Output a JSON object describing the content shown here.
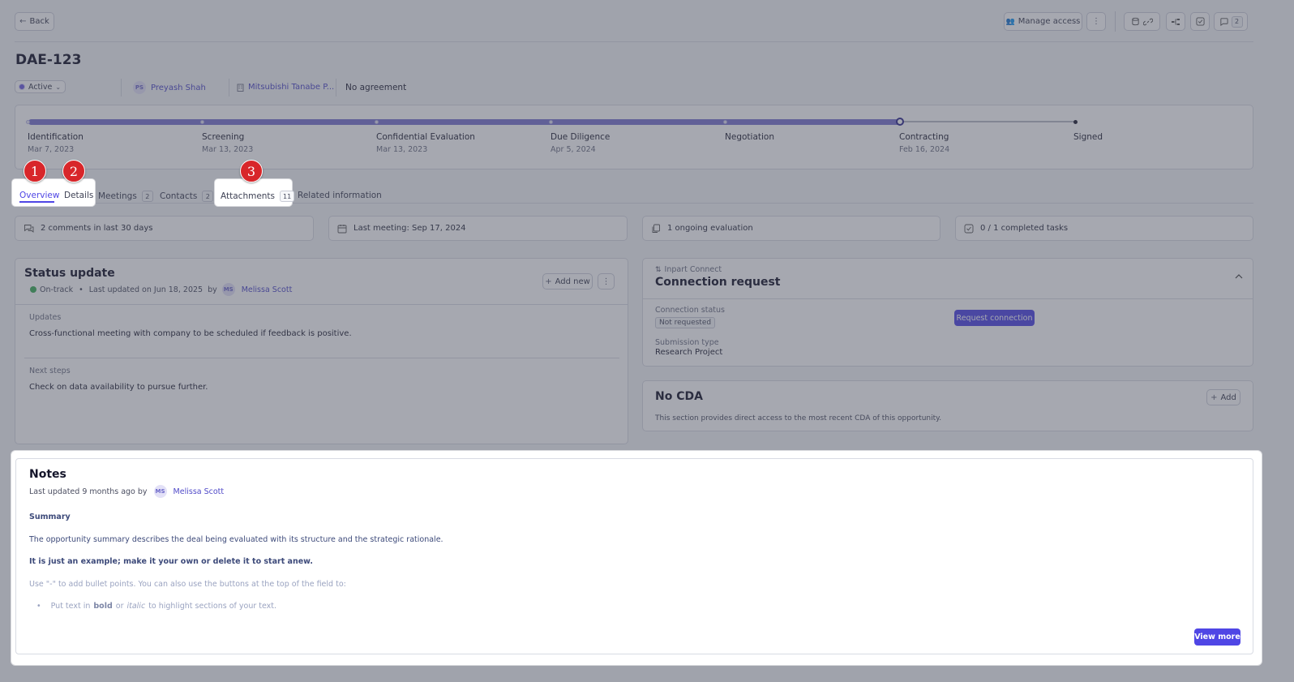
{
  "header": {
    "back_label": "Back",
    "manage_access_label": "Manage access",
    "comments_count": "2"
  },
  "deal": {
    "id": "DAE-123",
    "status": "Active",
    "owner_initials": "PS",
    "owner_name": "Preyash Shah",
    "company": "Mitsubishi Tanabe P...",
    "agreement": "No agreement"
  },
  "pipeline": {
    "stages": [
      {
        "label": "Identification",
        "date": "Mar 7, 2023"
      },
      {
        "label": "Screening",
        "date": "Mar 13, 2023"
      },
      {
        "label": "Confidential Evaluation",
        "date": "Mar 13, 2023"
      },
      {
        "label": "Due Diligence",
        "date": "Apr 5, 2024"
      },
      {
        "label": "Negotiation",
        "date": ""
      },
      {
        "label": "Contracting",
        "date": "Feb 16, 2024"
      },
      {
        "label": "Signed",
        "date": ""
      }
    ],
    "current_stage": "Contracting"
  },
  "tabs": [
    {
      "label": "Overview",
      "count": ""
    },
    {
      "label": "Details",
      "count": ""
    },
    {
      "label": "Meetings",
      "count": "2"
    },
    {
      "label": "Contacts",
      "count": "2"
    },
    {
      "label": "Attachments",
      "count": "11"
    },
    {
      "label": "Related information",
      "count": ""
    }
  ],
  "markers": [
    "1",
    "2",
    "3"
  ],
  "summary": {
    "comments": "2 comments in last 30 days",
    "last_meeting": "Last meeting: Sep 17, 2024",
    "evaluations": "1 ongoing evaluation",
    "tasks": "0 / 1 completed tasks"
  },
  "status_update": {
    "title": "Status update",
    "state": "On-track",
    "last_updated": "Last updated on Jun 18, 2025",
    "by": "by",
    "author_initials": "MS",
    "author": "Melissa Scott",
    "add_new_label": "Add new",
    "updates_label": "Updates",
    "updates_text": "Cross-functional meeting with company to be scheduled if feedback is positive.",
    "next_steps_label": "Next steps",
    "next_steps_text": "Check on data availability to pursue further."
  },
  "connection": {
    "source": "Inpart Connect",
    "title": "Connection request",
    "status_label": "Connection status",
    "status_value": "Not requested",
    "submission_label": "Submission type",
    "submission_value": "Research Project",
    "request_label": "Request connection"
  },
  "cda": {
    "title": "No CDA",
    "add_label": "Add",
    "description": "This section provides direct access to the most recent CDA of this opportunity."
  },
  "notes": {
    "title": "Notes",
    "last_updated": "Last updated 9 months ago by",
    "author_initials": "MS",
    "author": "Melissa Scott",
    "summary_heading": "Summary",
    "line1": "The opportunity summary describes the deal being evaluated with its structure and the strategic rationale.",
    "line2": "It is just an example; make it your own or delete it to start anew.",
    "line3": "Use \"-\" to add bullet points. You can also use the buttons at the top of the field to:",
    "bullet_prefix": "Put text in",
    "bullet_bold": "bold",
    "bullet_or": "or",
    "bullet_italic": "italic",
    "bullet_suffix": "to highlight sections of your text.",
    "view_more_label": "View more"
  },
  "colors": {
    "accent": "#4f46e5",
    "progress": "#7b76cf",
    "marker": "#d8262a",
    "on_track": "#3fae5a"
  }
}
